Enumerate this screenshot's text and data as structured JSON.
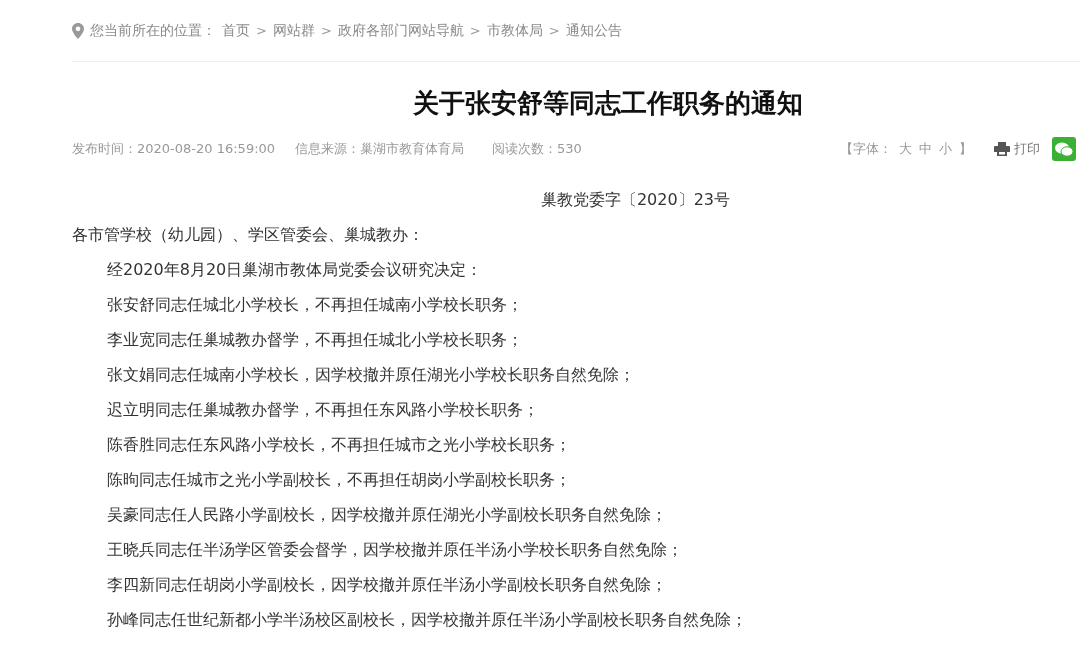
{
  "breadcrumb": {
    "prefix": "您当前所在的位置：",
    "separator": ">",
    "items": [
      "首页",
      "网站群",
      "政府各部门网站导航",
      "市教体局",
      "通知公告"
    ]
  },
  "article": {
    "title": "关于张安舒等同志工作职务的通知",
    "meta": [
      "发布时间：2020-08-20 16:59:00",
      "信息来源：巢湖市教育体育局",
      "阅读次数：530"
    ],
    "font_size": {
      "open": "【字体：",
      "options": [
        "大",
        "中",
        "小"
      ],
      "close": "】"
    },
    "print": "打印",
    "doc_number": "巢教党委字〔2020〕23号",
    "salutation": "各市管学校（幼儿园）、学区管委会、巢城教办：",
    "paragraphs": [
      "经2020年8月20日巢湖市教体局党委会议研究决定：",
      "张安舒同志任城北小学校长，不再担任城南小学校长职务；",
      "李业宽同志任巢城教办督学，不再担任城北小学校长职务；",
      "张文娟同志任城南小学校长，因学校撤并原任湖光小学校长职务自然免除；",
      "迟立明同志任巢城教办督学，不再担任东风路小学校长职务；",
      "陈香胜同志任东风路小学校长，不再担任城市之光小学校长职务；",
      "陈昫同志任城市之光小学副校长，不再担任胡岗小学副校长职务；",
      "吴豪同志任人民路小学副校长，因学校撤并原任湖光小学副校长职务自然免除；",
      "王晓兵同志任半汤学区管委会督学，因学校撤并原任半汤小学校长职务自然免除；",
      "李四新同志任胡岗小学副校长，因学校撤并原任半汤小学副校长职务自然免除；",
      "孙峰同志任世纪新都小学半汤校区副校长，因学校撤并原任半汤小学副校长职务自然免除；"
    ]
  }
}
